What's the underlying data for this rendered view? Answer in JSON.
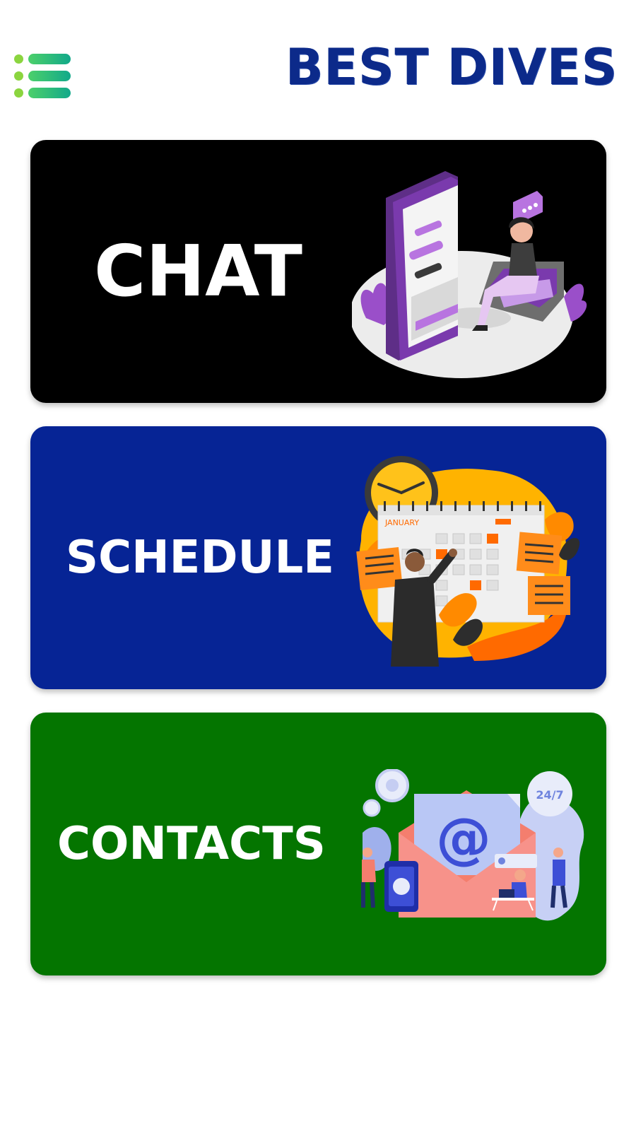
{
  "header": {
    "title": "BEST DIVES"
  },
  "cards": [
    {
      "label": "CHAT",
      "color": "#000000"
    },
    {
      "label": "SCHEDULE",
      "color": "#062495"
    },
    {
      "label": "CONTACTS",
      "color": "#047500"
    }
  ],
  "schedule_illustration": {
    "month": "JANUARY"
  },
  "contacts_illustration": {
    "badge": "24/7",
    "at_symbol": "@"
  },
  "icons": {
    "menu": "menu-icon"
  }
}
